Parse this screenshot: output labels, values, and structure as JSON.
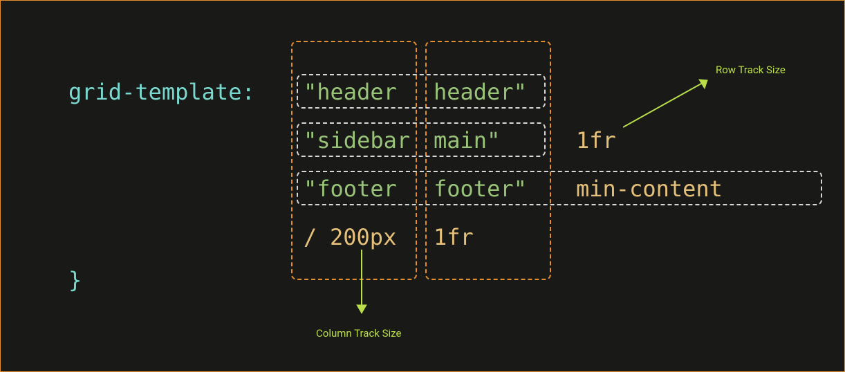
{
  "code": {
    "property": "grid-template:",
    "row1_col1": "\"header",
    "row1_col2": "header\"",
    "row2_col1": "\"sidebar",
    "row2_col2": "main\"",
    "row2_size": "1fr",
    "row3_col1": "\"footer",
    "row3_col2": "footer\"",
    "row3_size": "min-content",
    "col_prefix": "/",
    "col1_size": "200px",
    "col2_size": "1fr",
    "closing_brace": "}"
  },
  "annotations": {
    "row_track": "Row Track Size",
    "col_track": "Column Track Size"
  }
}
